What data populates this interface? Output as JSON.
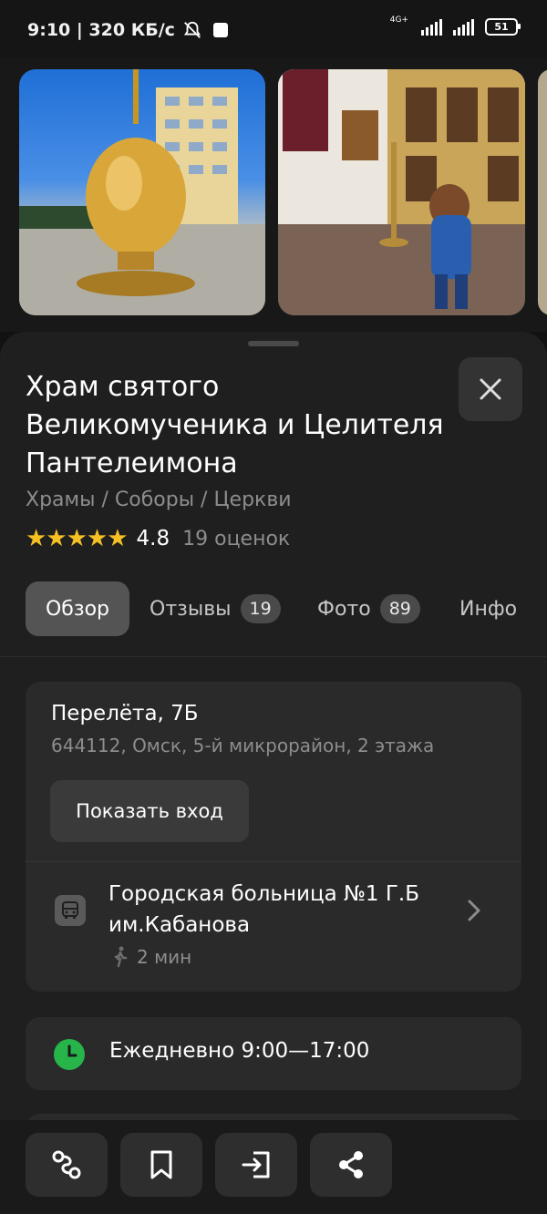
{
  "status_bar": {
    "time_speed": "9:10 | 320 КБ/с",
    "network": "4G+",
    "battery": "51"
  },
  "gallery": {
    "photos": [
      {
        "icon": "church-dome-photo"
      },
      {
        "icon": "church-interior-photo"
      },
      {
        "icon": "partial-photo"
      }
    ]
  },
  "place": {
    "title": "Храм святого Великомученика и Целителя Пантелеимона",
    "category": "Храмы / Соборы / Церкви",
    "stars": "★★★★★",
    "rating": "4.8",
    "rating_count": "19 оценок"
  },
  "tabs": [
    {
      "label": "Обзор",
      "badge": ""
    },
    {
      "label": "Отзывы",
      "badge": "19"
    },
    {
      "label": "Фото",
      "badge": "89"
    },
    {
      "label": "Инфо",
      "badge": ""
    }
  ],
  "address": {
    "street": "Перелёта, 7Б",
    "details": "644112, Омск, 5-й микрорайон, 2 этажа",
    "show_entrance_label": "Показать вход"
  },
  "transit": {
    "stop_name": "Городская больница №1 Г.Б им.Кабанова",
    "walk_time": "2 мин"
  },
  "hours": {
    "text": "Ежедневно 9:00—17:00",
    "status_color": "#27b54a"
  },
  "bottom_bar": {
    "buttons": [
      "route-icon",
      "bookmark-icon",
      "enter-icon",
      "share-icon"
    ]
  },
  "colors": {
    "background": "#121212",
    "sheet": "#1f1f1f",
    "card": "#2a2a2a",
    "star": "#f6c025",
    "open_green": "#27b54a"
  }
}
